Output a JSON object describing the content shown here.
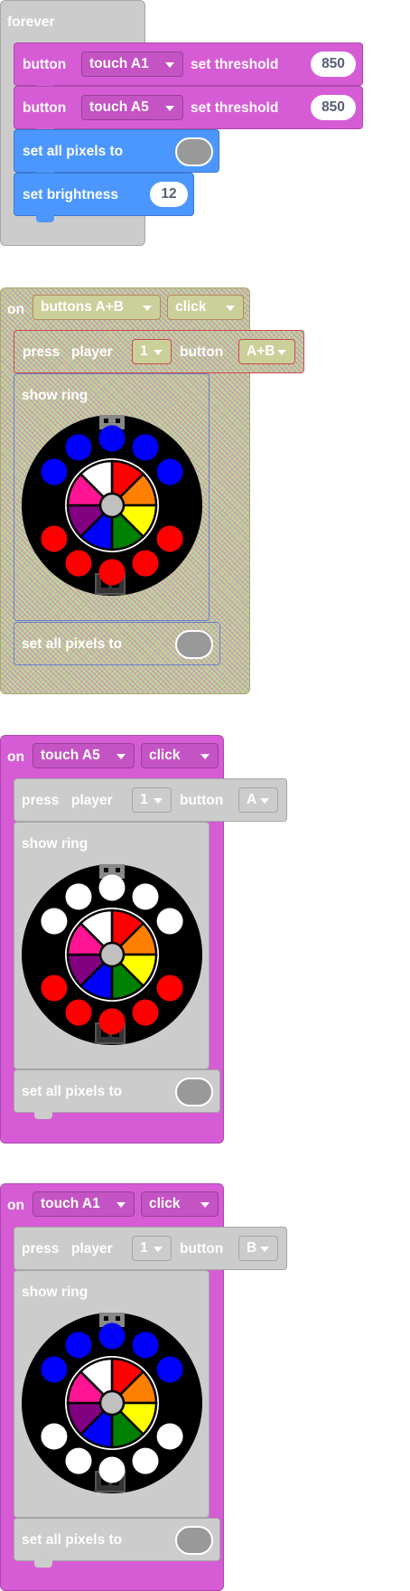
{
  "forever_block": {
    "label": "forever",
    "touch_rows": [
      {
        "label": "button",
        "dropdown": "touch A1",
        "threshold_label": "set threshold",
        "value": "850"
      },
      {
        "label": "button",
        "dropdown": "touch A5",
        "threshold_label": "set threshold",
        "value": "850"
      }
    ],
    "set_all_pixels_label": "set all pixels to",
    "set_brightness_label": "set brightness",
    "brightness_value": "12"
  },
  "event_blocks": [
    {
      "on_label": "on",
      "trigger": "buttons A+B",
      "action": "click",
      "press_label": "press",
      "player_label": "player",
      "player_value": "1",
      "button_label": "button",
      "button_value": "A+B",
      "show_ring_label": "show ring",
      "set_all_label": "set all pixels to",
      "ring_leds": [
        "blue",
        "blue",
        "blue",
        "blue",
        "blue",
        "red",
        "red",
        "red",
        "red",
        "red"
      ]
    },
    {
      "on_label": "on",
      "trigger": "touch A5",
      "action": "click",
      "press_label": "press",
      "player_label": "player",
      "player_value": "1",
      "button_label": "button",
      "button_value": "A",
      "show_ring_label": "show ring",
      "set_all_label": "set all pixels to",
      "ring_leds": [
        "white",
        "white",
        "white",
        "white",
        "white",
        "red",
        "red",
        "red",
        "red",
        "red"
      ]
    },
    {
      "on_label": "on",
      "trigger": "touch A1",
      "action": "click",
      "press_label": "press",
      "player_label": "player",
      "player_value": "1",
      "button_label": "button",
      "button_value": "B",
      "show_ring_label": "show ring",
      "set_all_label": "set all pixels to",
      "ring_leds": [
        "blue",
        "blue",
        "blue",
        "blue",
        "blue",
        "white",
        "white",
        "white",
        "white",
        "white"
      ]
    }
  ],
  "palette": {
    "pink_block": "#d65cd6",
    "blue_block": "#4c97ff",
    "grey_block": "#cccccc",
    "led_red": "#ff0000",
    "led_blue": "#0000ff",
    "led_white": "#ffffff",
    "wheel_segments": [
      "#ff0000",
      "#ff8000",
      "#ffff00",
      "#008000",
      "#0000ff",
      "#800080",
      "#ff1493",
      "#ffffff"
    ],
    "swatch_off": "#999999"
  }
}
